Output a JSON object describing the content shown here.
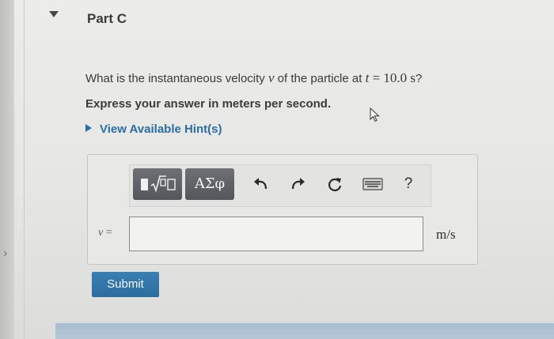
{
  "part": {
    "title": "Part C"
  },
  "question": {
    "prefix": "What is the instantaneous velocity ",
    "variable": "v",
    "middle": " of the particle at ",
    "time_var": "t",
    "equals": " = ",
    "time_value": "10.0",
    "time_unit": "s",
    "suffix": "?"
  },
  "instruction": "Express your answer in meters per second.",
  "hint_link": "View Available Hint(s)",
  "toolbar": {
    "templates_icon": "sqrt-template-icon",
    "symbols_label": "ΑΣφ",
    "undo_icon": "undo-icon",
    "redo_icon": "redo-icon",
    "reset_icon": "reset-icon",
    "keyboard_icon": "keyboard-icon",
    "help_label": "?"
  },
  "answer": {
    "variable": "v",
    "equals": " =",
    "value": "",
    "unit": "m/s"
  },
  "submit_label": "Submit",
  "colors": {
    "link": "#2b6ea3",
    "submit": "#2f72a5",
    "toolbar_button": "#5f6166"
  }
}
